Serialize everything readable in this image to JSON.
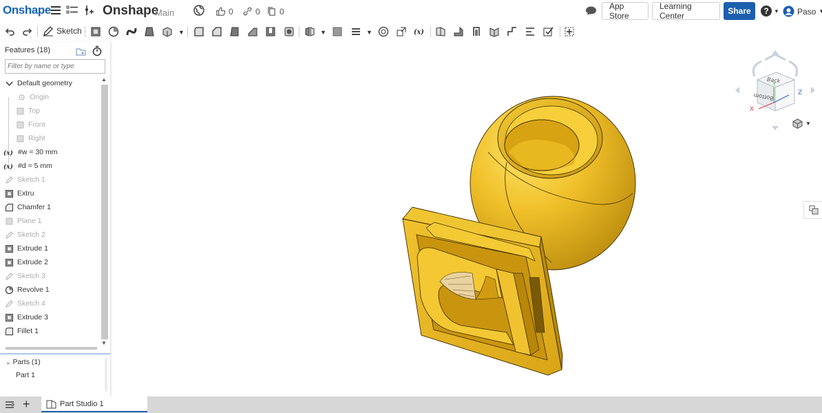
{
  "app": {
    "logo": "Onshape",
    "document_title": "Onshape",
    "workspace": "Main",
    "likes": "0",
    "links": "0",
    "copies": "0"
  },
  "topbar": {
    "app_store": "App Store",
    "learning_center": "Learning Center",
    "share": "Share",
    "user": "Paso"
  },
  "toolbar": {
    "sketch_label": "Sketch"
  },
  "feature_panel": {
    "header": "Features (18)",
    "filter_placeholder": "Filter by name or type",
    "items": [
      {
        "label": "Default geometry",
        "icon": "chevron-down-icon",
        "dim": false
      },
      {
        "label": "Origin",
        "icon": "origin-icon",
        "dim": true
      },
      {
        "label": "Top",
        "icon": "plane-icon",
        "dim": true
      },
      {
        "label": "Front",
        "icon": "plane-icon",
        "dim": true
      },
      {
        "label": "Right",
        "icon": "plane-icon",
        "dim": true
      },
      {
        "label": "#w = 30 mm",
        "icon": "variable-icon",
        "dim": false
      },
      {
        "label": "#d = 5 mm",
        "icon": "variable-icon",
        "dim": false
      },
      {
        "label": "Sketch 1",
        "icon": "sketch-icon",
        "dim": true
      },
      {
        "label": "Extru",
        "icon": "extrude-icon",
        "dim": false
      },
      {
        "label": "Chamfer 1",
        "icon": "chamfer-icon",
        "dim": false
      },
      {
        "label": "Plane 1",
        "icon": "plane-icon",
        "dim": true
      },
      {
        "label": "Sketch 2",
        "icon": "sketch-icon",
        "dim": true
      },
      {
        "label": "Extrude 1",
        "icon": "extrude-icon",
        "dim": false
      },
      {
        "label": "Extrude 2",
        "icon": "extrude-icon",
        "dim": false
      },
      {
        "label": "Sketch 3",
        "icon": "sketch-icon",
        "dim": true
      },
      {
        "label": "Revolve 1",
        "icon": "revolve-icon",
        "dim": false
      },
      {
        "label": "Sketch 4",
        "icon": "sketch-icon",
        "dim": true
      },
      {
        "label": "Extrude 3",
        "icon": "extrude-icon",
        "dim": false
      },
      {
        "label": "Fillet 1",
        "icon": "fillet-icon",
        "dim": false
      }
    ],
    "parts_header": "Parts (1)",
    "parts": [
      "Part 1"
    ]
  },
  "navcube": {
    "face_top": "Back",
    "face_front": "Bottom",
    "axis_x": "X",
    "axis_y": "Y",
    "axis_z": "Z"
  },
  "bottom": {
    "tab_label": "Part Studio 1"
  },
  "colors": {
    "brand": "#1664b8",
    "share": "#1b5fae",
    "part_gold": "#e6b419"
  }
}
